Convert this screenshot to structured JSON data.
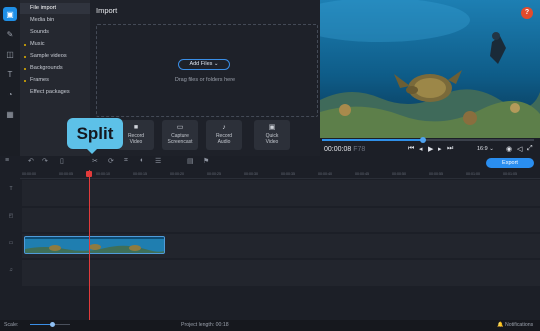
{
  "rail": {
    "items": [
      "import-icon",
      "wand-icon",
      "transitions-icon",
      "titles-icon",
      "stickers-icon",
      "more-icon"
    ]
  },
  "sidebar": {
    "items": [
      {
        "label": "File import",
        "dot": false,
        "active": true
      },
      {
        "label": "Media bin",
        "dot": false,
        "active": false
      },
      {
        "label": "Sounds",
        "dot": false,
        "active": false
      },
      {
        "label": "Music",
        "dot": true,
        "active": false
      },
      {
        "label": "Sample videos",
        "dot": true,
        "active": false
      },
      {
        "label": "Backgrounds",
        "dot": true,
        "active": false
      },
      {
        "label": "Frames",
        "dot": true,
        "active": false
      },
      {
        "label": "Effect packages",
        "dot": false,
        "active": false
      }
    ]
  },
  "import": {
    "title": "Import",
    "add_files": "Add Files",
    "hint": "Drag files or folders here",
    "tiles": [
      {
        "label1": "Record",
        "label2": "Video",
        "icon": "camera-icon"
      },
      {
        "label1": "Capture",
        "label2": "Screencast",
        "icon": "screen-icon"
      },
      {
        "label1": "Record",
        "label2": "Audio",
        "icon": "mic-icon"
      },
      {
        "label1": "Quick",
        "label2": "Video",
        "icon": "quick-icon"
      }
    ]
  },
  "tooltip": {
    "label": "Split"
  },
  "preview": {
    "help": "?",
    "timecode_main": "00:00:08",
    "timecode_dim": "F78",
    "aspect": "16:9",
    "scrub_progress": 0.48
  },
  "toolbar": {
    "export": "Export"
  },
  "ruler": {
    "ticks": [
      "00:00:00",
      "00:00:05",
      "00:00:10",
      "00:00:15",
      "00:00:20",
      "00:00:25",
      "00:00:30",
      "00:00:35",
      "00:00:40",
      "00:00:45",
      "00:00:50",
      "00:00:55",
      "00:01:00",
      "00:01:05"
    ]
  },
  "status": {
    "scale": "Scale:",
    "project_length": "Project length:  00:18",
    "notifications": "Notifications",
    "zoom_level": 0.55
  },
  "colors": {
    "accent": "#2a8ef0",
    "tooltip": "#5dc1e8",
    "playhead": "#e23b3b",
    "help": "#e34b2c"
  }
}
